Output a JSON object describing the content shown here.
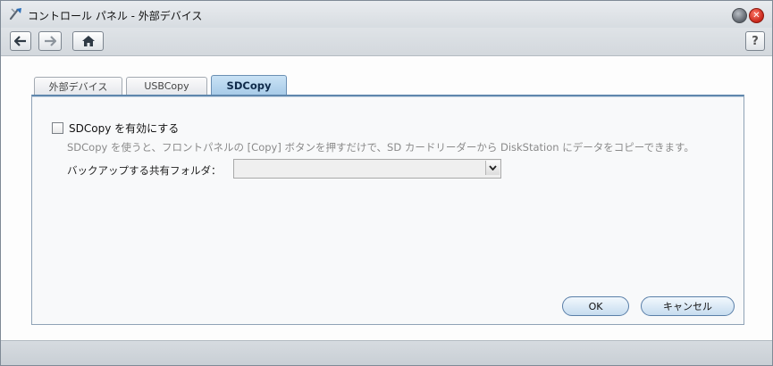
{
  "window": {
    "title": "コントロール パネル - 外部デバイス"
  },
  "toolbar": {
    "help_label": "?"
  },
  "tabs": [
    {
      "label": "外部デバイス"
    },
    {
      "label": "USBCopy"
    },
    {
      "label": "SDCopy"
    }
  ],
  "active_tab": "SDCopy",
  "sdcopy": {
    "enable_label": "SDCopy を有効にする",
    "enable_checked": false,
    "description": "SDCopy を使うと、フロントパネルの [Copy] ボタンを押すだけで、SD カードリーダーから DiskStation にデータをコピーできます。",
    "folder_label": "バックアップする共有フォルダ：",
    "folder_value": ""
  },
  "buttons": {
    "ok_label": "OK",
    "cancel_label": "キャンセル"
  },
  "icons": {
    "app": "control-panel-icon",
    "back": "arrow-left-icon",
    "forward": "arrow-right-icon",
    "home": "home-icon"
  },
  "colors": {
    "accent": "#5f87ad",
    "active_tab": "#a8cbe8",
    "close": "#c8261a"
  }
}
